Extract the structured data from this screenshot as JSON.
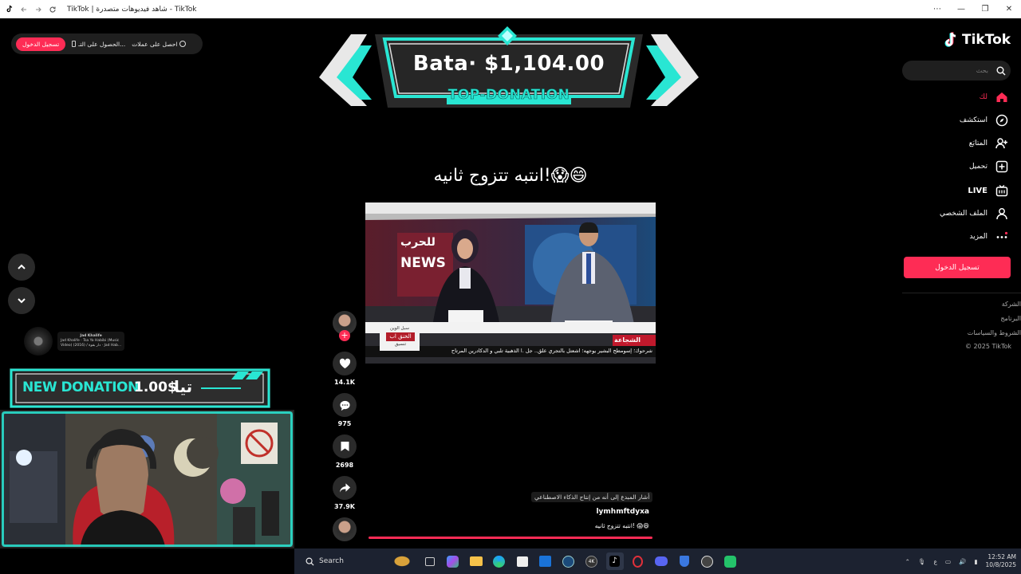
{
  "window": {
    "title": "TikTok | شاهد فيديوهات متصدرة - TikTok",
    "controls": [
      "more-icon",
      "minimize-icon",
      "restore-icon",
      "close-icon"
    ]
  },
  "top_pill": {
    "coins_label": "احصل على عملات",
    "app_label": "الحصول على التـ...",
    "login_label": "تسجيل الدخول"
  },
  "banner": {
    "amount": "Bata· $1,104.00",
    "subtitle": "TOP-DONATION"
  },
  "video": {
    "caption": "انتبه تتزوج ثانيه!😱😄",
    "author": "lymhmftdyxa",
    "description": "انتبه تتزوج ثانيه! 😱😄",
    "ai_tag": "أشار المبدع إلى أنه من إنتاج الذكاء الاصطناعي",
    "overlay": {
      "channel_tag": "الشجاعة",
      "ticker": "شرحوك؛ إسومطح البشير يوجهه؛ اشعتل بالتجري علق.. جل .ا الذهبية تلبي و الدكادرين المرتاح",
      "lower_box_top": "سبل الوين",
      "lower_box_main": "الخنق اب",
      "lower_box_sub": "تنسيق",
      "news_text": "NEWS",
      "bg_text": "للحرب"
    }
  },
  "actions": {
    "likes": "14.1K",
    "comments": "975",
    "saves": "2698",
    "shares": "37.9K"
  },
  "sidebar": {
    "logo": "TikTok",
    "search_placeholder": "بحث",
    "items": [
      {
        "label": "لك",
        "icon": "home-icon",
        "active": true
      },
      {
        "label": "استكشف",
        "icon": "compass-icon"
      },
      {
        "label": "المتابَع",
        "icon": "follow-icon"
      },
      {
        "label": "تحميل",
        "icon": "upload-icon"
      },
      {
        "label": "LIVE",
        "icon": "live-icon"
      },
      {
        "label": "الملف الشخصي",
        "icon": "profile-icon"
      },
      {
        "label": "المزيد",
        "icon": "more-dots-icon"
      }
    ],
    "login_button": "تسجيل الدخول",
    "footer": [
      "الشركة",
      "البرنامج",
      "الشروط والسياسات",
      "© 2025 TikTok"
    ]
  },
  "music": {
    "artist": "Jad Khalife",
    "line1": "Jad Khalife · Tsa Ya Habibi (Music",
    "line2": "Video) (2016) / دار بقوة · Jad Hab..."
  },
  "donation": {
    "label": "NEW DONATION",
    "amount": "1.00$",
    "name": "تيا"
  },
  "taskbar": {
    "search_label": "Search",
    "apps": [
      "weather-icon",
      "task-view-icon",
      "m365-icon",
      "file-explorer-icon",
      "edge-icon",
      "store-icon",
      "outlook-icon",
      "steam-icon",
      "4k-icon",
      "tiktok-icon",
      "opera-gx-icon",
      "discord-icon",
      "shield-icon",
      "obs-icon",
      "chat-icon"
    ],
    "tray": {
      "lang": "ع",
      "time": "12:52 AM",
      "date": "10/8/2025"
    }
  },
  "colors": {
    "accent": "#fe2c55",
    "banner_teal": "#29e6d3",
    "taskbar": "#1c2230"
  }
}
